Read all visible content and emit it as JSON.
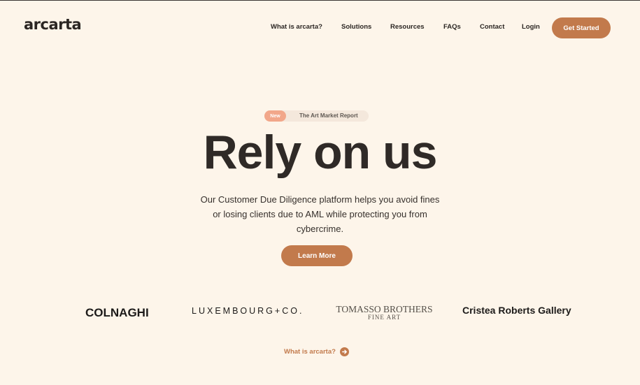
{
  "header": {
    "logo": "arcarta",
    "nav": [
      {
        "label": "What is arcarta?"
      },
      {
        "label": "Solutions"
      },
      {
        "label": "Resources"
      },
      {
        "label": "FAQs"
      },
      {
        "label": "Contact"
      },
      {
        "label": "Login"
      }
    ],
    "cta": "Get Started"
  },
  "announcement": {
    "badge": "New",
    "text": "The Art Market Report"
  },
  "hero": {
    "title": "Rely on us",
    "subtitle": "Our Customer Due Diligence platform helps you avoid fines or losing clients due to AML while protecting you from cybercrime.",
    "cta": "Learn More"
  },
  "clients": {
    "colnaghi": "COLNAGHI",
    "luxembourg": "LUXEMBOURG+CO.",
    "tomasso_line1": "TOMASSO BROTHERS",
    "tomasso_line2": "FINE ART",
    "cristea": "Cristea Roberts Gallery"
  },
  "footer_link": {
    "label": "What is arcarta?",
    "icon": "arrow-right-circle-icon"
  },
  "colors": {
    "background": "#fdf5ea",
    "accent": "#c27a4c",
    "badge": "#f2a78a",
    "text": "#2f2a27"
  }
}
